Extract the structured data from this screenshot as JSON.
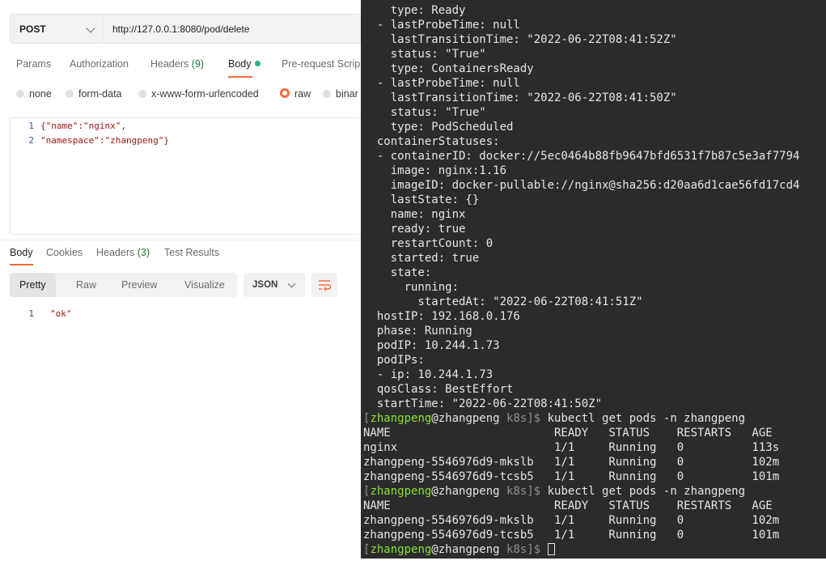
{
  "request": {
    "method": "POST",
    "url": "http://127.0.0.1:8080/pod/delete",
    "tabs": [
      {
        "label": "Params"
      },
      {
        "label": "Authorization"
      },
      {
        "label": "Headers",
        "count": "(9)"
      },
      {
        "label": "Body"
      },
      {
        "label": "Pre-request Scrip"
      }
    ],
    "body_modes": [
      "none",
      "form-data",
      "x-www-form-urlencoded",
      "raw",
      "binar"
    ],
    "selected_body_mode": "raw",
    "body_lines": [
      {
        "num": "1",
        "text": "{\"name\":\"nginx\","
      },
      {
        "num": "2",
        "text": "\"namespace\":\"zhangpeng\"}"
      }
    ]
  },
  "response": {
    "tabs": [
      {
        "label": "Body"
      },
      {
        "label": "Cookies"
      },
      {
        "label": "Headers",
        "count": "(3)"
      },
      {
        "label": "Test Results"
      }
    ],
    "view_modes": [
      "Pretty",
      "Raw",
      "Preview",
      "Visualize"
    ],
    "format": "JSON",
    "lines": [
      {
        "num": "1",
        "text": "\"ok\""
      }
    ]
  },
  "terminal": {
    "yaml_lines": [
      "    type: Ready",
      "  - lastProbeTime: null",
      "    lastTransitionTime: \"2022-06-22T08:41:52Z\"",
      "    status: \"True\"",
      "    type: ContainersReady",
      "  - lastProbeTime: null",
      "    lastTransitionTime: \"2022-06-22T08:41:50Z\"",
      "    status: \"True\"",
      "    type: PodScheduled",
      "  containerStatuses:",
      "  - containerID: docker://5ec0464b88fb9647bfd6531f7b87c5e3af7794",
      "    image: nginx:1.16",
      "    imageID: docker-pullable://nginx@sha256:d20aa6d1cae56fd17cd4",
      "    lastState: {}",
      "    name: nginx",
      "    ready: true",
      "    restartCount: 0",
      "    started: true",
      "    state:",
      "      running:",
      "        startedAt: \"2022-06-22T08:41:51Z\"",
      "  hostIP: 192.168.0.176",
      "  phase: Running",
      "  podIP: 10.244.1.73",
      "  podIPs:",
      "  - ip: 10.244.1.73",
      "  qosClass: BestEffort",
      "  startTime: \"2022-06-22T08:41:50Z\""
    ],
    "prompt": {
      "open": "[",
      "user": "zhangpeng",
      "at": "@zhangpeng",
      "dir": "k8s",
      "close": "]$ "
    },
    "command": "kubectl get pods -n zhangpeng",
    "tables": [
      {
        "header": "NAME                        READY   STATUS    RESTARTS   AGE",
        "rows": [
          "nginx                       1/1     Running   0          113s",
          "zhangpeng-5546976d9-mkslb   1/1     Running   0          102m",
          "zhangpeng-5546976d9-tcsb5   1/1     Running   0          101m"
        ]
      },
      {
        "header": "NAME                        READY   STATUS    RESTARTS   AGE",
        "rows": [
          "zhangpeng-5546976d9-mkslb   1/1     Running   0          102m",
          "zhangpeng-5546976d9-tcsb5   1/1     Running   0          101m"
        ]
      }
    ]
  }
}
